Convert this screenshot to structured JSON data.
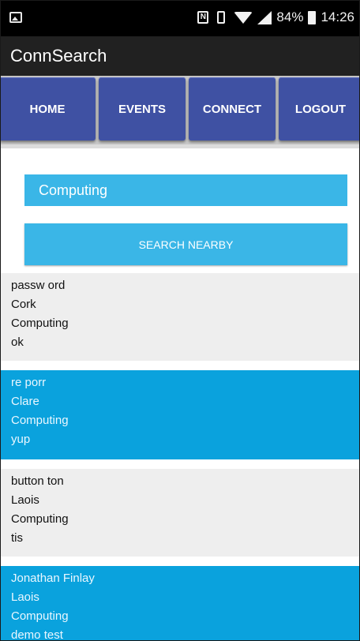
{
  "status_bar": {
    "battery_percent": "84%",
    "time": "14:26",
    "icons": [
      "photo-icon",
      "nfc-icon",
      "vibrate-icon",
      "wifi-icon",
      "signal-icon",
      "battery-icon"
    ]
  },
  "app": {
    "title": "ConnSearch"
  },
  "tabs": [
    {
      "label": "HOME"
    },
    {
      "label": "EVENTS"
    },
    {
      "label": "CONNECT"
    },
    {
      "label": "LOGOUT"
    }
  ],
  "search": {
    "value": "Computing",
    "button_label": "SEARCH NEARBY"
  },
  "results": [
    {
      "lines": [
        "passw ord",
        "Cork",
        "Computing",
        "ok"
      ]
    },
    {
      "lines": [
        "re porr",
        "Clare",
        "Computing",
        "yup"
      ]
    },
    {
      "lines": [
        "button ton",
        "Laois",
        "Computing",
        "tis"
      ]
    },
    {
      "lines": [
        "Jonathan Finlay",
        "Laois",
        "Computing",
        "demo test"
      ]
    }
  ],
  "colors": {
    "tab_bg": "#3f51a3",
    "accent": "#3ab6e7",
    "row_blue": "#0aa2dd",
    "row_light": "#eeeeee"
  }
}
